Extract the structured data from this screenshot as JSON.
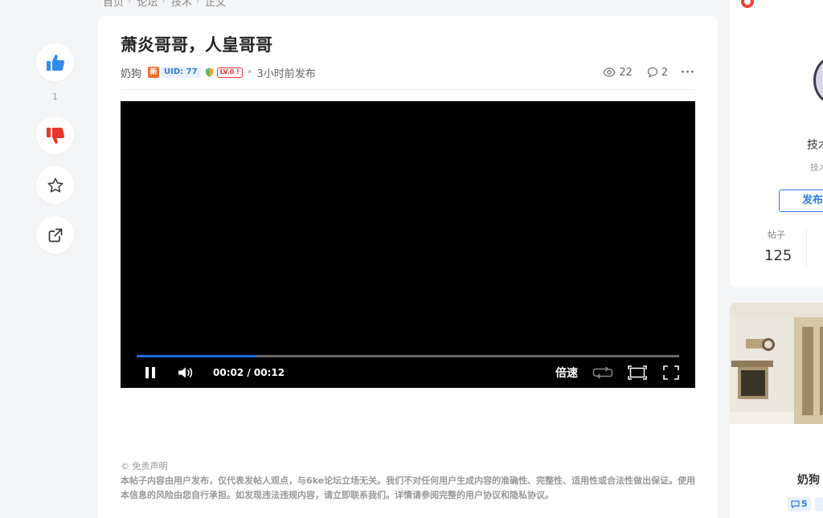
{
  "breadcrumb": [
    "首页",
    "论坛",
    "技术",
    "正文"
  ],
  "rail": {
    "like_count": "1"
  },
  "post": {
    "title": "萧炎哥哥，人皇哥哥",
    "author": "奶狗",
    "badge_new": "新",
    "uid": "UID: 77",
    "level": "LV.0 !",
    "time": "3小时前发布",
    "views": "22",
    "comments": "2",
    "more": "···"
  },
  "video": {
    "time": "00:02 / 00:12",
    "speed_label": "倍速",
    "progress_fraction": 0.22
  },
  "disclaimer": {
    "head": "© 免责声明",
    "body": "本帖子内容由用户发布，仅代表发帖人观点，与6ke论坛立场无关。我们不对任何用户生成内容的准确性、完整性、适用性或合法性做出保证。使用本信息的风险由您自行承担。如发现违法违规内容，请立即联系我们。详情请参阅完整的用户协议和隐私协议。"
  },
  "sidebar": {
    "category_name": "技术",
    "category_desc": "技术",
    "publish_label": "发布",
    "posts_label": "帖子",
    "posts_value": "125"
  },
  "author_card": {
    "name": "奶狗",
    "tag": "5"
  },
  "colors": {
    "accent": "#2f7de1",
    "like": "#2f8bf0",
    "dislike": "#e8352a",
    "progress": "#1e6fe0"
  }
}
